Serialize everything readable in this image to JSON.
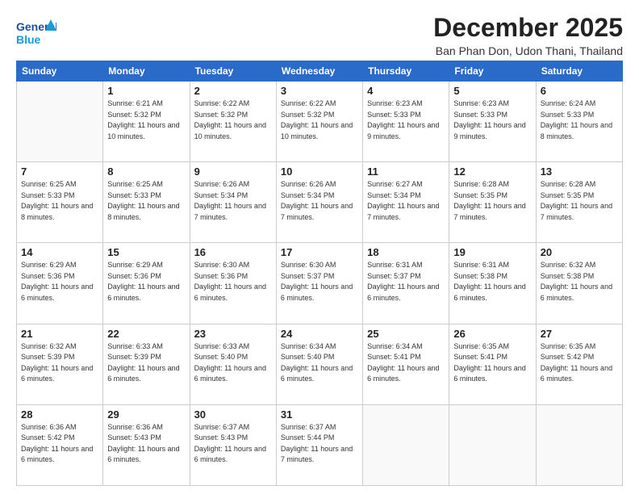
{
  "header": {
    "logo_line1": "General",
    "logo_line2": "Blue",
    "title": "December 2025",
    "subtitle": "Ban Phan Don, Udon Thani, Thailand"
  },
  "days_of_week": [
    "Sunday",
    "Monday",
    "Tuesday",
    "Wednesday",
    "Thursday",
    "Friday",
    "Saturday"
  ],
  "weeks": [
    [
      {
        "day": "",
        "sunrise": "",
        "sunset": "",
        "daylight": ""
      },
      {
        "day": "1",
        "sunrise": "Sunrise: 6:21 AM",
        "sunset": "Sunset: 5:32 PM",
        "daylight": "Daylight: 11 hours and 10 minutes."
      },
      {
        "day": "2",
        "sunrise": "Sunrise: 6:22 AM",
        "sunset": "Sunset: 5:32 PM",
        "daylight": "Daylight: 11 hours and 10 minutes."
      },
      {
        "day": "3",
        "sunrise": "Sunrise: 6:22 AM",
        "sunset": "Sunset: 5:32 PM",
        "daylight": "Daylight: 11 hours and 10 minutes."
      },
      {
        "day": "4",
        "sunrise": "Sunrise: 6:23 AM",
        "sunset": "Sunset: 5:33 PM",
        "daylight": "Daylight: 11 hours and 9 minutes."
      },
      {
        "day": "5",
        "sunrise": "Sunrise: 6:23 AM",
        "sunset": "Sunset: 5:33 PM",
        "daylight": "Daylight: 11 hours and 9 minutes."
      },
      {
        "day": "6",
        "sunrise": "Sunrise: 6:24 AM",
        "sunset": "Sunset: 5:33 PM",
        "daylight": "Daylight: 11 hours and 8 minutes."
      }
    ],
    [
      {
        "day": "7",
        "sunrise": "Sunrise: 6:25 AM",
        "sunset": "Sunset: 5:33 PM",
        "daylight": "Daylight: 11 hours and 8 minutes."
      },
      {
        "day": "8",
        "sunrise": "Sunrise: 6:25 AM",
        "sunset": "Sunset: 5:33 PM",
        "daylight": "Daylight: 11 hours and 8 minutes."
      },
      {
        "day": "9",
        "sunrise": "Sunrise: 6:26 AM",
        "sunset": "Sunset: 5:34 PM",
        "daylight": "Daylight: 11 hours and 7 minutes."
      },
      {
        "day": "10",
        "sunrise": "Sunrise: 6:26 AM",
        "sunset": "Sunset: 5:34 PM",
        "daylight": "Daylight: 11 hours and 7 minutes."
      },
      {
        "day": "11",
        "sunrise": "Sunrise: 6:27 AM",
        "sunset": "Sunset: 5:34 PM",
        "daylight": "Daylight: 11 hours and 7 minutes."
      },
      {
        "day": "12",
        "sunrise": "Sunrise: 6:28 AM",
        "sunset": "Sunset: 5:35 PM",
        "daylight": "Daylight: 11 hours and 7 minutes."
      },
      {
        "day": "13",
        "sunrise": "Sunrise: 6:28 AM",
        "sunset": "Sunset: 5:35 PM",
        "daylight": "Daylight: 11 hours and 7 minutes."
      }
    ],
    [
      {
        "day": "14",
        "sunrise": "Sunrise: 6:29 AM",
        "sunset": "Sunset: 5:36 PM",
        "daylight": "Daylight: 11 hours and 6 minutes."
      },
      {
        "day": "15",
        "sunrise": "Sunrise: 6:29 AM",
        "sunset": "Sunset: 5:36 PM",
        "daylight": "Daylight: 11 hours and 6 minutes."
      },
      {
        "day": "16",
        "sunrise": "Sunrise: 6:30 AM",
        "sunset": "Sunset: 5:36 PM",
        "daylight": "Daylight: 11 hours and 6 minutes."
      },
      {
        "day": "17",
        "sunrise": "Sunrise: 6:30 AM",
        "sunset": "Sunset: 5:37 PM",
        "daylight": "Daylight: 11 hours and 6 minutes."
      },
      {
        "day": "18",
        "sunrise": "Sunrise: 6:31 AM",
        "sunset": "Sunset: 5:37 PM",
        "daylight": "Daylight: 11 hours and 6 minutes."
      },
      {
        "day": "19",
        "sunrise": "Sunrise: 6:31 AM",
        "sunset": "Sunset: 5:38 PM",
        "daylight": "Daylight: 11 hours and 6 minutes."
      },
      {
        "day": "20",
        "sunrise": "Sunrise: 6:32 AM",
        "sunset": "Sunset: 5:38 PM",
        "daylight": "Daylight: 11 hours and 6 minutes."
      }
    ],
    [
      {
        "day": "21",
        "sunrise": "Sunrise: 6:32 AM",
        "sunset": "Sunset: 5:39 PM",
        "daylight": "Daylight: 11 hours and 6 minutes."
      },
      {
        "day": "22",
        "sunrise": "Sunrise: 6:33 AM",
        "sunset": "Sunset: 5:39 PM",
        "daylight": "Daylight: 11 hours and 6 minutes."
      },
      {
        "day": "23",
        "sunrise": "Sunrise: 6:33 AM",
        "sunset": "Sunset: 5:40 PM",
        "daylight": "Daylight: 11 hours and 6 minutes."
      },
      {
        "day": "24",
        "sunrise": "Sunrise: 6:34 AM",
        "sunset": "Sunset: 5:40 PM",
        "daylight": "Daylight: 11 hours and 6 minutes."
      },
      {
        "day": "25",
        "sunrise": "Sunrise: 6:34 AM",
        "sunset": "Sunset: 5:41 PM",
        "daylight": "Daylight: 11 hours and 6 minutes."
      },
      {
        "day": "26",
        "sunrise": "Sunrise: 6:35 AM",
        "sunset": "Sunset: 5:41 PM",
        "daylight": "Daylight: 11 hours and 6 minutes."
      },
      {
        "day": "27",
        "sunrise": "Sunrise: 6:35 AM",
        "sunset": "Sunset: 5:42 PM",
        "daylight": "Daylight: 11 hours and 6 minutes."
      }
    ],
    [
      {
        "day": "28",
        "sunrise": "Sunrise: 6:36 AM",
        "sunset": "Sunset: 5:42 PM",
        "daylight": "Daylight: 11 hours and 6 minutes."
      },
      {
        "day": "29",
        "sunrise": "Sunrise: 6:36 AM",
        "sunset": "Sunset: 5:43 PM",
        "daylight": "Daylight: 11 hours and 6 minutes."
      },
      {
        "day": "30",
        "sunrise": "Sunrise: 6:37 AM",
        "sunset": "Sunset: 5:43 PM",
        "daylight": "Daylight: 11 hours and 6 minutes."
      },
      {
        "day": "31",
        "sunrise": "Sunrise: 6:37 AM",
        "sunset": "Sunset: 5:44 PM",
        "daylight": "Daylight: 11 hours and 7 minutes."
      },
      {
        "day": "",
        "sunrise": "",
        "sunset": "",
        "daylight": ""
      },
      {
        "day": "",
        "sunrise": "",
        "sunset": "",
        "daylight": ""
      },
      {
        "day": "",
        "sunrise": "",
        "sunset": "",
        "daylight": ""
      }
    ]
  ]
}
